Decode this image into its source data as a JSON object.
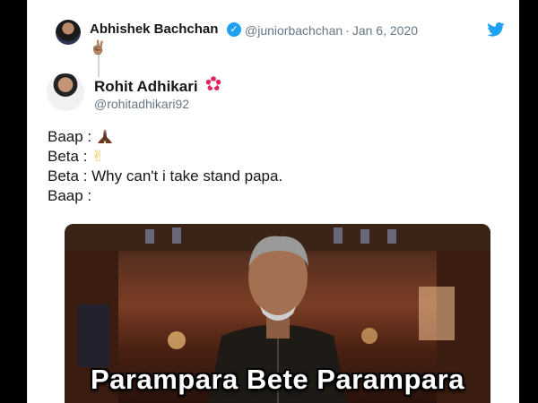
{
  "parent_tweet": {
    "name": "Abhishek Bachchan",
    "verified_glyph": "✓",
    "handle": "@juniorbachchan",
    "separator": "·",
    "date": "Jan 6, 2020",
    "text_emoji": "✌🏽",
    "platform_icon": "twitter-bird-icon"
  },
  "reply_tweet": {
    "name": "Rohit Adhikari",
    "handle": "@rohitadhikari92",
    "lines": [
      {
        "prefix": "Baap :",
        "emoji": "pray-icon"
      },
      {
        "prefix": "Beta :",
        "emoji": "victory-hand-icon"
      },
      {
        "prefix": "Beta : Why can't i take stand papa.",
        "emoji": ""
      },
      {
        "prefix": "Baap :",
        "emoji": ""
      }
    ],
    "victory_emoji": "✌"
  },
  "meme": {
    "caption": "Parampara Bete Parampara"
  },
  "colors": {
    "twitter_blue": "#1da1f2",
    "text_primary": "#14171a",
    "text_secondary": "#657786",
    "badge_red": "#e0245e"
  }
}
